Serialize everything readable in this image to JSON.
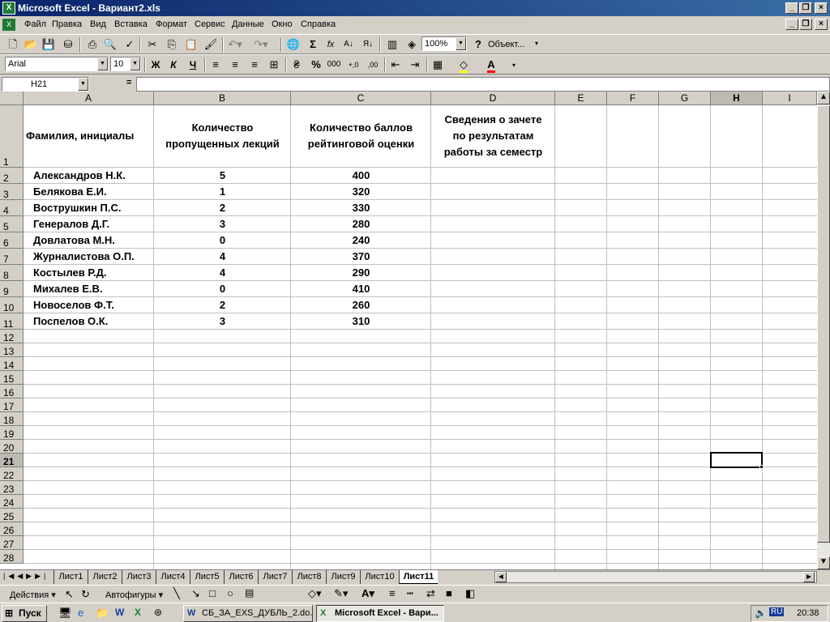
{
  "window": {
    "title": "Microsoft Excel - Вариант2.xls",
    "app_icon": "excel-icon"
  },
  "menu": [
    "Файл",
    "Правка",
    "Вид",
    "Вставка",
    "Формат",
    "Сервис",
    "Данные",
    "Окно",
    "Справка"
  ],
  "toolbar": {
    "zoom": "100%",
    "object_label": "Объект..."
  },
  "format_toolbar": {
    "font": "Arial",
    "size": "10",
    "bold": "Ж",
    "italic": "К",
    "underline": "Ч",
    "percent": "%",
    "thousands": "000"
  },
  "formula_bar": {
    "name_box": "H21",
    "equals": "=",
    "content": ""
  },
  "columns": [
    "A",
    "B",
    "C",
    "D",
    "E",
    "F",
    "G",
    "H",
    "I"
  ],
  "header_row": {
    "a": "Фамилия, инициалы",
    "b1": "Количество",
    "b2": "пропущенных лекций",
    "c1": "Количество баллов",
    "c2": "рейтинговой оценки",
    "d1": "Сведения о зачете",
    "d2": "по результатам",
    "d3": "работы за семестр"
  },
  "rows": [
    {
      "name": "Александров Н.К.",
      "missed": "5",
      "score": "400"
    },
    {
      "name": "Белякова Е.И.",
      "missed": "1",
      "score": "320"
    },
    {
      "name": "Вострушкин П.С.",
      "missed": "2",
      "score": "330"
    },
    {
      "name": "Генералов Д.Г.",
      "missed": "3",
      "score": "280"
    },
    {
      "name": "Довлатова М.Н.",
      "missed": "0",
      "score": "240"
    },
    {
      "name": "Журналистова О.П.",
      "missed": "4",
      "score": "370"
    },
    {
      "name": "Костылев Р.Д.",
      "missed": "4",
      "score": "290"
    },
    {
      "name": "Михалев Е.В.",
      "missed": "0",
      "score": "410"
    },
    {
      "name": "Новоселов Ф.Т.",
      "missed": "2",
      "score": "260"
    },
    {
      "name": "Поспелов О.К.",
      "missed": "3",
      "score": "310"
    }
  ],
  "row_numbers": [
    "1",
    "2",
    "3",
    "4",
    "5",
    "6",
    "7",
    "8",
    "9",
    "10",
    "11",
    "12",
    "13",
    "14",
    "15",
    "16",
    "17",
    "18",
    "19",
    "20",
    "21",
    "22",
    "23",
    "24",
    "25",
    "26",
    "27",
    "28"
  ],
  "sheet_tabs": [
    "Лист1",
    "Лист2",
    "Лист3",
    "Лист4",
    "Лист5",
    "Лист6",
    "Лист7",
    "Лист8",
    "Лист9",
    "Лист10",
    "Лист11"
  ],
  "active_sheet": "Лист11",
  "draw_toolbar": {
    "actions": "Действия ▾",
    "autoshapes": "Автофигуры ▾"
  },
  "taskbar": {
    "start": "Пуск",
    "tasks": [
      "СБ_ЗА_EXS_ДУБЛЬ_2.do...",
      "Microsoft Excel - Вари..."
    ],
    "lang": "RU",
    "clock": "20:38"
  },
  "colors": {
    "title_bar": "#0a246a",
    "excel_green": "#1e7b34",
    "selection_border": "#000000"
  }
}
